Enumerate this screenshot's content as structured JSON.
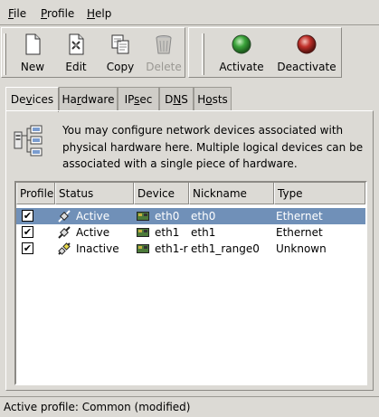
{
  "menubar": {
    "items": [
      {
        "label": "File",
        "mnemonic": "F",
        "rest": "ile"
      },
      {
        "label": "Profile",
        "mnemonic": "P",
        "rest": "rofile"
      },
      {
        "label": "Help",
        "mnemonic": "H",
        "rest": "elp"
      }
    ]
  },
  "toolbar": {
    "new_label": "New",
    "edit_label": "Edit",
    "copy_label": "Copy",
    "delete_label": "Delete",
    "activate_label": "Activate",
    "deactivate_label": "Deactivate",
    "activate_color": "#3aa33a",
    "deactivate_color": "#c0302a"
  },
  "tabs": [
    {
      "label": "Devices",
      "pre": "De",
      "mn": "v",
      "post": "ices"
    },
    {
      "label": "Hardware",
      "pre": "Ha",
      "mn": "r",
      "post": "dware"
    },
    {
      "label": "IPsec",
      "pre": "IP",
      "mn": "s",
      "post": "ec"
    },
    {
      "label": "DNS",
      "pre": "D",
      "mn": "N",
      "post": "S"
    },
    {
      "label": "Hosts",
      "pre": "H",
      "mn": "o",
      "post": "sts"
    }
  ],
  "info": {
    "text": "You may configure network devices associated with physical hardware here.  Multiple logical devices can be associated with a single piece of hardware."
  },
  "table": {
    "columns": [
      "Profile",
      "Status",
      "Device",
      "Nickname",
      "Type"
    ],
    "rows": [
      {
        "profile": "✔",
        "status": "Active",
        "device": "eth0",
        "nickname": "eth0",
        "type": "Ethernet",
        "selected": true
      },
      {
        "profile": "✔",
        "status": "Active",
        "device": "eth1",
        "nickname": "eth1",
        "type": "Ethernet",
        "selected": false
      },
      {
        "profile": "✔",
        "status": "Inactive",
        "device": "eth1-r",
        "nickname": "eth1_range0",
        "type": "Unknown",
        "selected": false
      }
    ]
  },
  "statusbar": {
    "text": "Active profile: Common (modified)"
  }
}
